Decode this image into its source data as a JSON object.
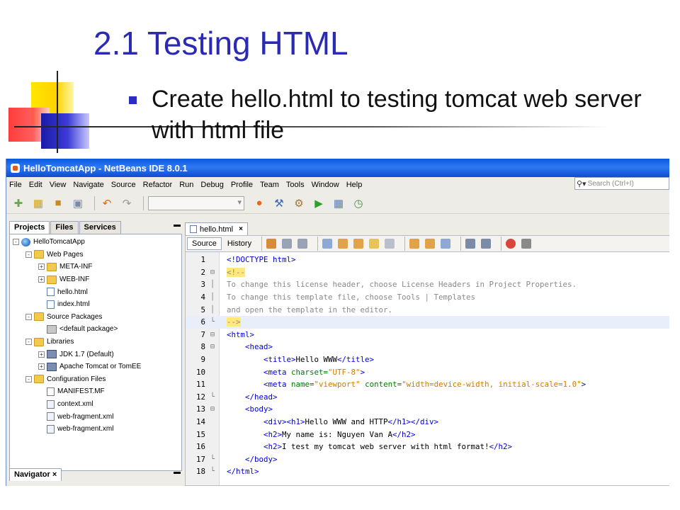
{
  "slide": {
    "title": "2.1 Testing HTML",
    "bullet": "Create hello.html to testing tomcat web server with html file"
  },
  "ide": {
    "window_title": "HelloTomcatApp - NetBeans IDE 8.0.1",
    "menu": [
      "File",
      "Edit",
      "View",
      "Navigate",
      "Source",
      "Refactor",
      "Run",
      "Debug",
      "Profile",
      "Team",
      "Tools",
      "Window",
      "Help"
    ],
    "search_placeholder": "Search (Ctrl+I)",
    "toolbar_icons": [
      "new-file-icon",
      "new-project-icon",
      "open-project-icon",
      "save-all-icon",
      "undo-icon",
      "redo-icon",
      "config-combo",
      "browser-icon",
      "build-icon",
      "clean-build-icon",
      "run-icon",
      "debug-icon",
      "profile-icon"
    ],
    "left_tabs": [
      "Projects",
      "Files",
      "Services"
    ],
    "navigator_tab": "Navigator",
    "tree": [
      {
        "level": 0,
        "label": "HelloTomcatApp",
        "icon": "globe",
        "exp": "-"
      },
      {
        "level": 1,
        "label": "Web Pages",
        "icon": "folder",
        "exp": "-"
      },
      {
        "level": 2,
        "label": "META-INF",
        "icon": "folder",
        "exp": "+"
      },
      {
        "level": 2,
        "label": "WEB-INF",
        "icon": "folder",
        "exp": "+"
      },
      {
        "level": 2,
        "label": "hello.html",
        "icon": "html",
        "exp": ""
      },
      {
        "level": 2,
        "label": "index.html",
        "icon": "html",
        "exp": ""
      },
      {
        "level": 1,
        "label": "Source Packages",
        "icon": "folder",
        "exp": "-"
      },
      {
        "level": 2,
        "label": "<default package>",
        "icon": "pkg",
        "exp": ""
      },
      {
        "level": 1,
        "label": "Libraries",
        "icon": "folder",
        "exp": "-"
      },
      {
        "level": 2,
        "label": "JDK 1.7 (Default)",
        "icon": "jar",
        "exp": "+"
      },
      {
        "level": 2,
        "label": "Apache Tomcat or TomEE",
        "icon": "jar",
        "exp": "+"
      },
      {
        "level": 1,
        "label": "Configuration Files",
        "icon": "folder",
        "exp": "-"
      },
      {
        "level": 2,
        "label": "MANIFEST.MF",
        "icon": "file",
        "exp": ""
      },
      {
        "level": 2,
        "label": "context.xml",
        "icon": "xml",
        "exp": ""
      },
      {
        "level": 2,
        "label": "web-fragment.xml",
        "icon": "xml",
        "exp": ""
      },
      {
        "level": 2,
        "label": "web-fragment.xml",
        "icon": "xml",
        "exp": ""
      }
    ],
    "editor_tab": "hello.html",
    "editor_views": [
      "Source",
      "History"
    ],
    "code_lines": [
      {
        "n": "1",
        "fold": "",
        "hl": false,
        "parts": [
          [
            "c-tag",
            "<!DOCTYPE html>"
          ]
        ]
      },
      {
        "n": "2",
        "fold": "-",
        "hl": false,
        "parts": [
          [
            "c-cmt c-sel",
            "<!--"
          ]
        ]
      },
      {
        "n": "3",
        "fold": "|",
        "hl": false,
        "parts": [
          [
            "c-cmt",
            "To change this license header, choose License Headers in Project Properties."
          ]
        ]
      },
      {
        "n": "4",
        "fold": "|",
        "hl": false,
        "parts": [
          [
            "c-cmt",
            "To change this template file, choose Tools | Templates"
          ]
        ]
      },
      {
        "n": "5",
        "fold": "|",
        "hl": false,
        "parts": [
          [
            "c-cmt",
            "and open the template in the editor."
          ]
        ]
      },
      {
        "n": "6",
        "fold": "L",
        "hl": true,
        "parts": [
          [
            "c-cmt c-sel",
            "-->"
          ]
        ]
      },
      {
        "n": "7",
        "fold": "-",
        "hl": false,
        "parts": [
          [
            "c-tag",
            "<html>"
          ]
        ]
      },
      {
        "n": "8",
        "fold": "-",
        "hl": false,
        "parts": [
          [
            "c-txt",
            "    "
          ],
          [
            "c-tag",
            "<head>"
          ]
        ]
      },
      {
        "n": "9",
        "fold": "",
        "hl": false,
        "parts": [
          [
            "c-txt",
            "        "
          ],
          [
            "c-tag",
            "<title>"
          ],
          [
            "c-txt",
            "Hello WWW"
          ],
          [
            "c-tag",
            "</title>"
          ]
        ]
      },
      {
        "n": "10",
        "fold": "",
        "hl": false,
        "parts": [
          [
            "c-txt",
            "        "
          ],
          [
            "c-tag",
            "<meta "
          ],
          [
            "c-attr",
            "charset="
          ],
          [
            "c-val",
            "\"UTF-8\""
          ],
          [
            "c-tag",
            ">"
          ]
        ]
      },
      {
        "n": "11",
        "fold": "",
        "hl": false,
        "parts": [
          [
            "c-txt",
            "        "
          ],
          [
            "c-tag",
            "<meta "
          ],
          [
            "c-attr",
            "name="
          ],
          [
            "c-val",
            "\"viewport\""
          ],
          [
            "c-txt",
            " "
          ],
          [
            "c-attr",
            "content="
          ],
          [
            "c-val",
            "\"width=device-width, initial-scale=1.0\""
          ],
          [
            "c-tag",
            ">"
          ]
        ]
      },
      {
        "n": "12",
        "fold": "L",
        "hl": false,
        "parts": [
          [
            "c-txt",
            "    "
          ],
          [
            "c-tag",
            "</head>"
          ]
        ]
      },
      {
        "n": "13",
        "fold": "-",
        "hl": false,
        "parts": [
          [
            "c-txt",
            "    "
          ],
          [
            "c-tag",
            "<body>"
          ]
        ]
      },
      {
        "n": "14",
        "fold": "",
        "hl": false,
        "parts": [
          [
            "c-txt",
            "        "
          ],
          [
            "c-tag",
            "<div><h1>"
          ],
          [
            "c-txt",
            "Hello WWW and HTTP"
          ],
          [
            "c-tag",
            "</h1></div>"
          ]
        ]
      },
      {
        "n": "15",
        "fold": "",
        "hl": false,
        "parts": [
          [
            "c-txt",
            "        "
          ],
          [
            "c-tag",
            "<h2>"
          ],
          [
            "c-txt",
            "My name is: Nguyen Van A"
          ],
          [
            "c-tag",
            "</h2>"
          ]
        ]
      },
      {
        "n": "16",
        "fold": "",
        "hl": false,
        "parts": [
          [
            "c-txt",
            "        "
          ],
          [
            "c-tag",
            "<h2>"
          ],
          [
            "c-txt",
            "I test my tomcat web server with html format!"
          ],
          [
            "c-tag",
            "</h2>"
          ]
        ]
      },
      {
        "n": "17",
        "fold": "L",
        "hl": false,
        "parts": [
          [
            "c-txt",
            "    "
          ],
          [
            "c-tag",
            "</body>"
          ]
        ]
      },
      {
        "n": "18",
        "fold": "L",
        "hl": false,
        "parts": [
          [
            "c-tag",
            "</html>"
          ]
        ]
      }
    ]
  }
}
